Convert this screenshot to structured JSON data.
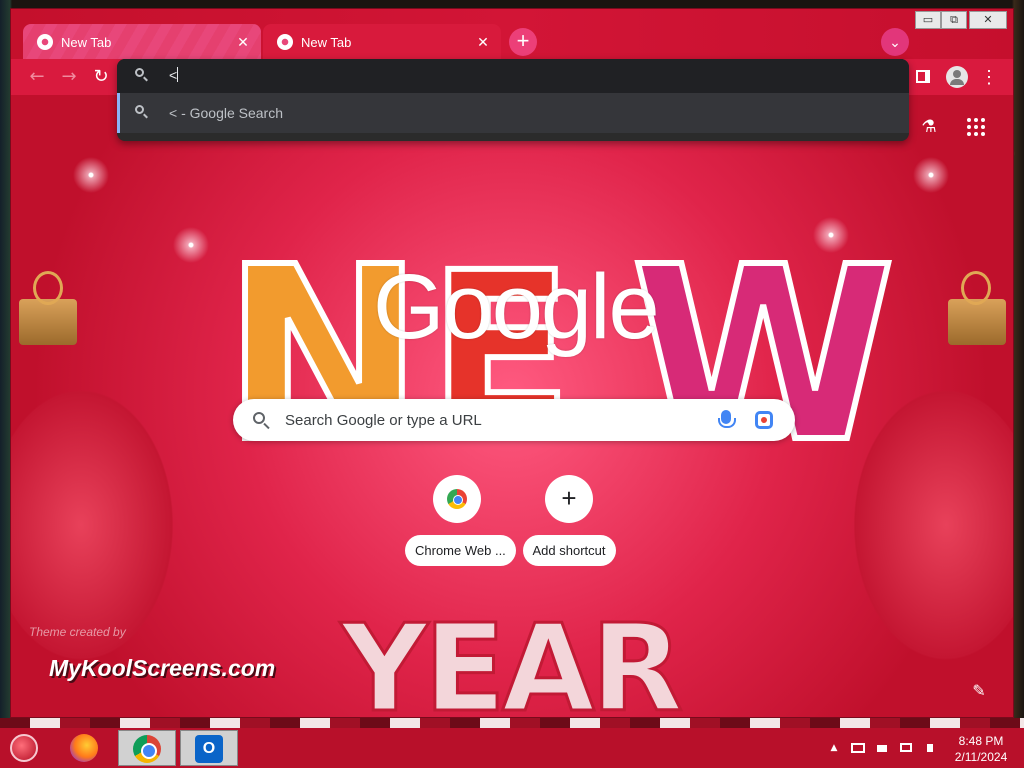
{
  "window": {
    "controls": {
      "minimize": "▭",
      "restore": "⧉",
      "close": "✕"
    }
  },
  "tabs": [
    {
      "label": "New Tab",
      "close": "✕",
      "icon": "chrome-icon",
      "state": "inactive"
    },
    {
      "label": "New Tab",
      "close": "✕",
      "icon": "chrome-icon",
      "state": "active"
    }
  ],
  "tabstrip": {
    "new_tab": "+",
    "tab_search": "⌄"
  },
  "toolbar": {
    "back": "←",
    "forward": "→",
    "reload": "↻",
    "menu": "⋮"
  },
  "omnibox": {
    "value": "<",
    "suggestions": [
      {
        "text": "< - Google Search",
        "icon": "search-icon"
      }
    ]
  },
  "ntp": {
    "logo_text": "Google",
    "search_placeholder": "Search Google or type a URL",
    "shortcuts": [
      {
        "label": "Chrome Web ...",
        "icon": "chrome-web-store-icon"
      },
      {
        "label": "Add shortcut",
        "icon": "plus-icon",
        "glyph": "+"
      }
    ],
    "theme_credit": "Theme created by",
    "brand_mark": "MyKoolScreens.com",
    "edit": "✎",
    "labs": "⚗"
  },
  "taskbar": {
    "apps": [
      "start-ornament-icon",
      "firefox-icon",
      "chrome-icon",
      "outlook-icon"
    ],
    "outlook_glyph": "O",
    "tray": {
      "chevron": "▲"
    },
    "clock": {
      "time": "8:48 PM",
      "date": "2/11/2024"
    }
  },
  "colors": {
    "theme": "#d91a3e",
    "omnibox_dark": "#202124",
    "focus_accent": "#8ab4f8"
  }
}
